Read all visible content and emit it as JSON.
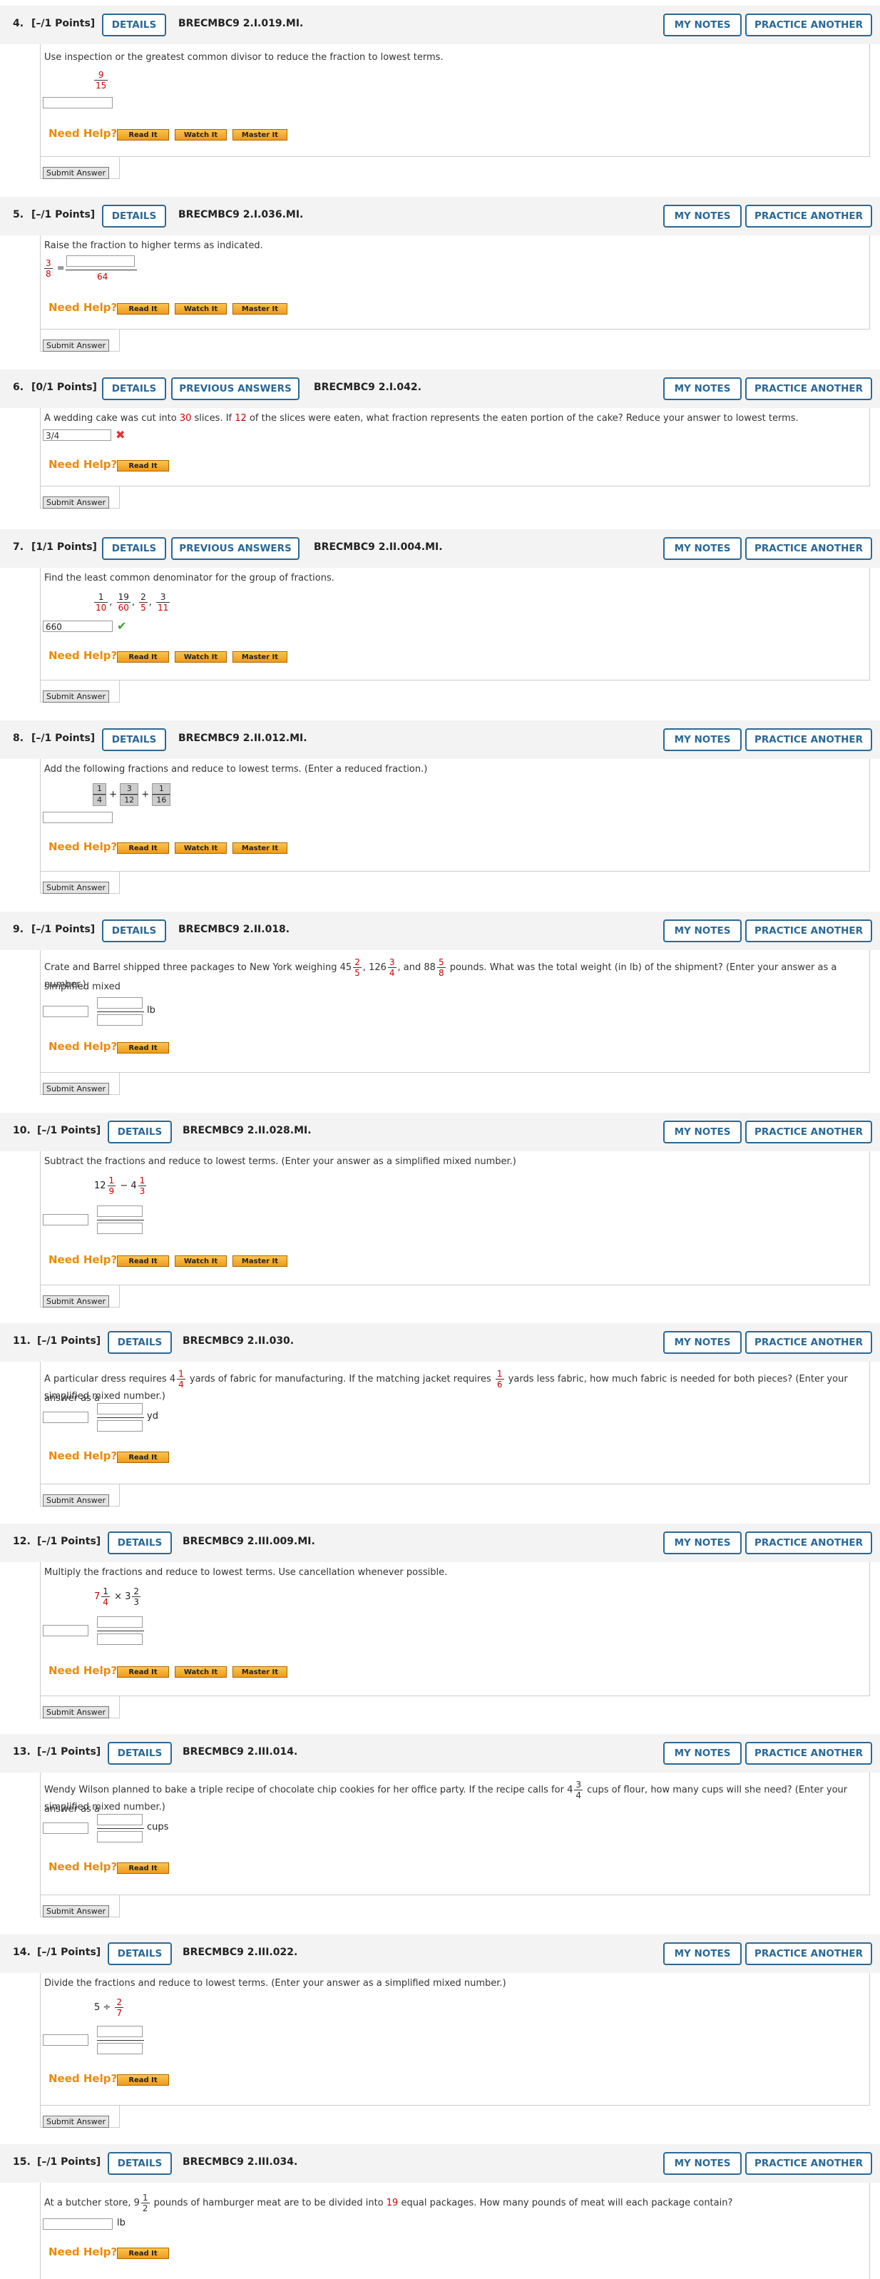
{
  "labels": {
    "details": "DETAILS",
    "previous_answers": "PREVIOUS ANSWERS",
    "my_notes": "MY NOTES",
    "practice_another": "PRACTICE ANOTHER",
    "need_help": "Need Help?",
    "read_it": "Read It",
    "watch_it": "Watch It",
    "master_it": "Master It",
    "submit_answer": "Submit Answer"
  },
  "questions": [
    {
      "num": "4.",
      "points": "[–/1 Points]",
      "code": "BRECMBC9 2.I.019.MI.",
      "prompt": "Use inspection or the greatest common divisor to reduce the fraction to lowest terms.",
      "frac_n": "9",
      "frac_d": "15"
    },
    {
      "num": "5.",
      "points": "[–/1 Points]",
      "code": "BRECMBC9 2.I.036.MI.",
      "prompt": "Raise the fraction to higher terms as indicated.",
      "frac_n": "3",
      "frac_d": "8",
      "eq": "=",
      "denom": "64"
    },
    {
      "num": "6.",
      "points": "[0/1 Points]",
      "code": "BRECMBC9 2.I.042.",
      "prompt_a": "A wedding cake was cut into ",
      "prompt_r1": "30",
      "prompt_b": " slices. If ",
      "prompt_r2": "12",
      "prompt_c": " of the slices were eaten, what fraction represents the eaten portion of the cake? Reduce your answer to lowest terms.",
      "answer": "3/4"
    },
    {
      "num": "7.",
      "points": "[1/1 Points]",
      "code": "BRECMBC9 2.II.004.MI.",
      "prompt": "Find the least common denominator for the group of fractions.",
      "fracs": [
        {
          "n": "1",
          "d": "10"
        },
        {
          "n": "19",
          "d": "60"
        },
        {
          "n": "2",
          "d": "5"
        },
        {
          "n": "3",
          "d": "11"
        }
      ],
      "sep": ",",
      "answer": "660"
    },
    {
      "num": "8.",
      "points": "[–/1 Points]",
      "code": "BRECMBC9 2.II.012.MI.",
      "prompt": "Add the following fractions and reduce to lowest terms. (Enter a reduced fraction.)",
      "fracs": [
        {
          "n": "1",
          "d": "4"
        },
        {
          "n": "3",
          "d": "12"
        },
        {
          "n": "1",
          "d": "16"
        }
      ],
      "plus": "+"
    },
    {
      "num": "9.",
      "points": "[–/1 Points]",
      "code": "BRECMBC9 2.II.018.",
      "prompt_a": "Crate and Barrel shipped three packages to New York weighing 45",
      "f1n": "2",
      "f1d": "5",
      "prompt_b": ", 126",
      "f2n": "3",
      "f2d": "4",
      "prompt_c": ", and 88",
      "f3n": "5",
      "f3d": "8",
      "prompt_d": " pounds. What was the total weight (in lb) of the shipment? (Enter your answer as a simplified mixed",
      "prompt_e": "number.)",
      "unit": "lb"
    },
    {
      "num": "10.",
      "points": "[–/1 Points]",
      "code": "BRECMBC9 2.II.028.MI.",
      "prompt": "Subtract the fractions and reduce to lowest terms. (Enter your answer as a simplified mixed number.)",
      "w1": "12",
      "f1n": "1",
      "f1d": "9",
      "minus": "−",
      "w2": "4",
      "f2n": "1",
      "f2d": "3"
    },
    {
      "num": "11.",
      "points": "[–/1 Points]",
      "code": "BRECMBC9 2.II.030.",
      "prompt_a": "A particular dress requires 4",
      "f1n": "1",
      "f1d": "4",
      "prompt_b": " yards of fabric for manufacturing. If the matching jacket requires ",
      "f2n": "1",
      "f2d": "6",
      "prompt_c": " yards less fabric, how much fabric is needed for both pieces? (Enter your answer as a",
      "prompt_d": "simplified mixed number.)",
      "unit": "yd"
    },
    {
      "num": "12.",
      "points": "[–/1 Points]",
      "code": "BRECMBC9 2.III.009.MI.",
      "prompt": "Multiply the fractions and reduce to lowest terms. Use cancellation whenever possible.",
      "w1": "7",
      "f1n": "1",
      "f1d": "4",
      "times": "×",
      "w2": "3",
      "f2n": "2",
      "f2d": "3"
    },
    {
      "num": "13.",
      "points": "[–/1 Points]",
      "code": "BRECMBC9 2.III.014.",
      "prompt_a": "Wendy Wilson planned to bake a triple recipe of chocolate chip cookies for her office party. If the recipe calls for 4",
      "f1n": "3",
      "f1d": "4",
      "prompt_b": " cups of flour, how many cups will she need? (Enter your answer as a",
      "prompt_c": "simplified mixed number.)",
      "unit": "cups"
    },
    {
      "num": "14.",
      "points": "[–/1 Points]",
      "code": "BRECMBC9 2.III.022.",
      "prompt": "Divide the fractions and reduce to lowest terms. (Enter your answer as a simplified mixed number.)",
      "w1": "5",
      "div": "÷",
      "f1n": "2",
      "f1d": "7"
    },
    {
      "num": "15.",
      "points": "[–/1 Points]",
      "code": "BRECMBC9 2.III.034.",
      "prompt_a": "At a butcher store, 9",
      "f1n": "1",
      "f1d": "2",
      "prompt_b": " pounds of hamburger meat are to be divided into ",
      "prompt_r": "19",
      "prompt_c": " equal packages. How many pounds of meat will each package contain?",
      "unit": "lb"
    }
  ],
  "colors": {
    "accent": "#2a6896",
    "help": "#e98b0c",
    "red": "#cc0000",
    "correct": "#3a9c2e",
    "wrong": "#e0302f"
  }
}
